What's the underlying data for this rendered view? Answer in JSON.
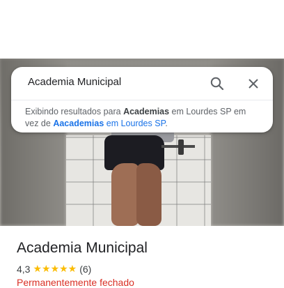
{
  "search": {
    "query": "Academia Municipal",
    "suggestion_prefix": "Exibindo resultados para ",
    "suggestion_bold1": "Academias",
    "suggestion_middle": " em Lourdes SP em vez de ",
    "suggestion_link_bold": "Aacademias",
    "suggestion_link_rest": " em Lourdes SP",
    "suggestion_end": "."
  },
  "place": {
    "name": "Academia Municipal",
    "rating": "4,3",
    "stars": "★★★★★",
    "review_count": "(6)",
    "status": "Permanentemente fechado"
  },
  "colors": {
    "star": "#fbbc04",
    "link": "#1a73e8",
    "closed_status": "#d93025"
  },
  "icons": {
    "search": "search-icon",
    "close": "close-icon"
  }
}
